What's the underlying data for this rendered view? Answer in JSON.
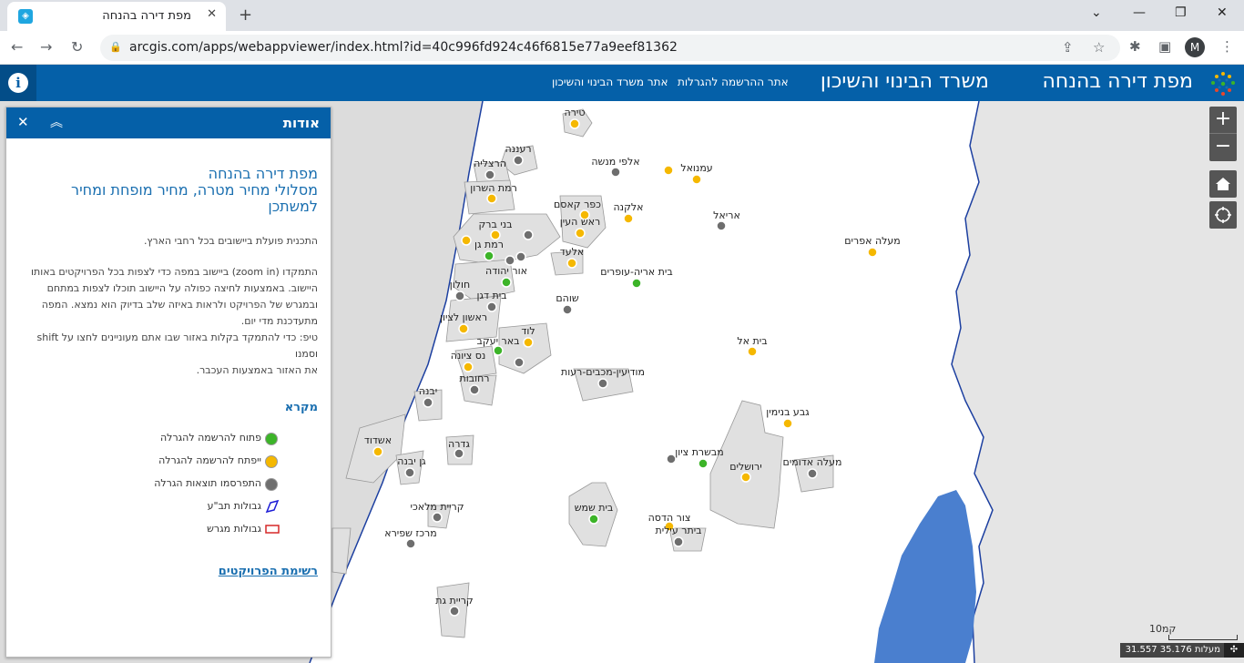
{
  "browser": {
    "tab_title": "מפת דירה בהנחה",
    "tab_close": "✕",
    "new_tab": "+",
    "url": "arcgis.com/apps/webappviewer/index.html?id=40c996fd924c46f6815e77a9eef81362",
    "profile_initial": "M",
    "window_controls": [
      "⌄",
      "—",
      "❐",
      "✕"
    ]
  },
  "header": {
    "app_title": "מפת דירה בהנחה",
    "subtitle": "משרד הבינוי והשיכון",
    "links": [
      "אתר ההרשמה להגרלות",
      "אתר משרד הבינוי והשיכון"
    ],
    "info_label": "i"
  },
  "panel": {
    "title": "אודות",
    "close": "✕",
    "collapse": "︽",
    "map_title_lines": [
      "מפת דירה בהנחה",
      "מסלולי מחיר מטרה, מחיר מופחת ומחיר",
      "למשתכן"
    ],
    "desc1": "התכנית פועלת ביישובים בכל רחבי הארץ.",
    "desc2_lines": [
      "התמקדו (zoom in) ביישוב במפה כדי לצפות בכל הפרויקטים באותו",
      "היישוב. באמצעות לחיצה כפולה על היישוב תוכלו לצפות במתחם",
      "ובמגרש של הפרויקט ולראות באיזה שלב בדיוק הוא נמצא. המפה",
      "מתעדכנת מדי יום.",
      "טיפ: כדי להתמקד בקלות באזור שבו אתם מעוניינים לחצו על shift וסמנו",
      "את האזור באמצעות העכבר."
    ],
    "legend_title": "מקרא",
    "legend": [
      {
        "label": "פתוח להרשמה להגרלה",
        "color": "#3cb428"
      },
      {
        "label": "ייפתח להרשמה להגרלה",
        "color": "#f5b800"
      },
      {
        "label": "התפרסמו תוצאות הגרלה",
        "color": "#6e6e6e"
      },
      {
        "label": "גבולות תב\"ע",
        "color": "#1c1cd6"
      },
      {
        "label": "גבולות מגרש",
        "color": "#d62828"
      }
    ],
    "projects_link": "רשימת הפרויקטים"
  },
  "map_controls": {
    "zoom_in": "+",
    "zoom_out": "−",
    "home_icon": "home-icon",
    "locate_icon": "locate-icon",
    "scale_label": "10קמ",
    "coords": "31.557 35.176 מעלות",
    "coord_icon": "✣"
  },
  "places": [
    {
      "name": "טירה",
      "status": "yellow"
    },
    {
      "name": "רעננה",
      "status": "gray"
    },
    {
      "name": "הרצליה",
      "status": "gray"
    },
    {
      "name": "רמת השרון",
      "status": "yellow"
    },
    {
      "name": "אלפי מנשה",
      "status": "gray"
    },
    {
      "name": "עמנואל",
      "status": "yellow"
    },
    {
      "name": "כפר קאסם",
      "status": "yellow"
    },
    {
      "name": "ראש העין",
      "status": "yellow"
    },
    {
      "name": "אלקנה",
      "status": "yellow"
    },
    {
      "name": "אריאל",
      "status": "gray"
    },
    {
      "name": "בני ברק",
      "status": "yellow"
    },
    {
      "name": "רמת גן",
      "status": "green"
    },
    {
      "name": "אלעד",
      "status": "yellow"
    },
    {
      "name": "מעלה אפרים",
      "status": "yellow"
    },
    {
      "name": "אור יהודה",
      "status": "green"
    },
    {
      "name": "בית אריה-עופרים",
      "status": "green"
    },
    {
      "name": "חולון",
      "status": "gray"
    },
    {
      "name": "בית דגן",
      "status": "gray"
    },
    {
      "name": "שוהם",
      "status": "gray"
    },
    {
      "name": "ראשון לציון",
      "status": "yellow"
    },
    {
      "name": "לוד",
      "status": "yellow"
    },
    {
      "name": "באר יעקב",
      "status": "green"
    },
    {
      "name": "נס ציונה",
      "status": "yellow"
    },
    {
      "name": "בית אל",
      "status": "yellow"
    },
    {
      "name": "רחובות",
      "status": "gray"
    },
    {
      "name": "מודיעין-מכבים-רעות",
      "status": "gray"
    },
    {
      "name": "יבנה",
      "status": "gray"
    },
    {
      "name": "גבע בנימין",
      "status": "yellow"
    },
    {
      "name": "אשדוד",
      "status": "yellow"
    },
    {
      "name": "גדרה",
      "status": "gray"
    },
    {
      "name": "מבשרת ציון",
      "status": "green"
    },
    {
      "name": "גן יבנה",
      "status": "gray"
    },
    {
      "name": "ירושלים",
      "status": "yellow"
    },
    {
      "name": "מעלה אדומים",
      "status": "gray"
    },
    {
      "name": "קריית מלאכי",
      "status": "gray"
    },
    {
      "name": "בית שמש",
      "status": "green"
    },
    {
      "name": "צור הדסה",
      "status": "yellow"
    },
    {
      "name": "ביתר עילית",
      "status": "gray"
    },
    {
      "name": "מרכז שפירא",
      "status": "gray"
    },
    {
      "name": "קריית גת",
      "status": "gray"
    }
  ]
}
